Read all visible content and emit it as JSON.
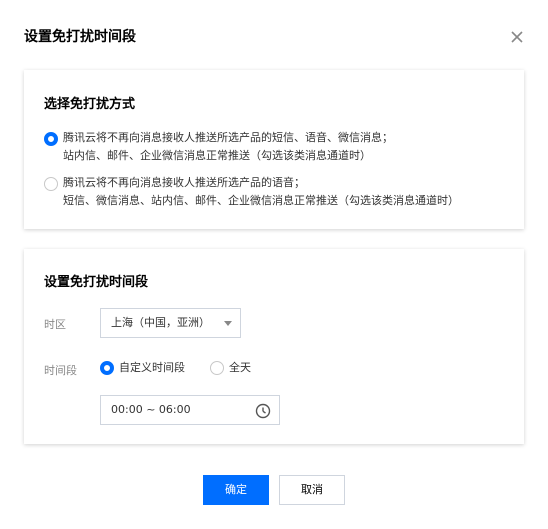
{
  "dialog": {
    "title": "设置免打扰时间段",
    "close_icon": "close-icon"
  },
  "mode_section": {
    "title": "选择免打扰方式",
    "options": [
      {
        "line1": "腾讯云将不再向消息接收人推送所选产品的短信、语音、微信消息；",
        "line2": "站内信、邮件、企业微信消息正常推送（勾选该类消息通道时）",
        "selected": true
      },
      {
        "line1": "腾讯云将不再向消息接收人推送所选产品的语音；",
        "line2": "短信、微信消息、站内信、邮件、企业微信消息正常推送（勾选该类消息通道时）",
        "selected": false
      }
    ]
  },
  "period_section": {
    "title": "设置免打扰时间段",
    "timezone_label": "时区",
    "timezone_value": "上海（中国，亚洲）",
    "period_label": "时间段",
    "period_options": [
      {
        "label": "自定义时间段",
        "selected": true
      },
      {
        "label": "全天",
        "selected": false
      }
    ],
    "time_range": "00:00 ~ 06:00",
    "clock_icon": "clock-icon"
  },
  "footer": {
    "confirm_label": "确定",
    "cancel_label": "取消"
  },
  "colors": {
    "primary": "#006eff",
    "border": "#cfd5de"
  }
}
